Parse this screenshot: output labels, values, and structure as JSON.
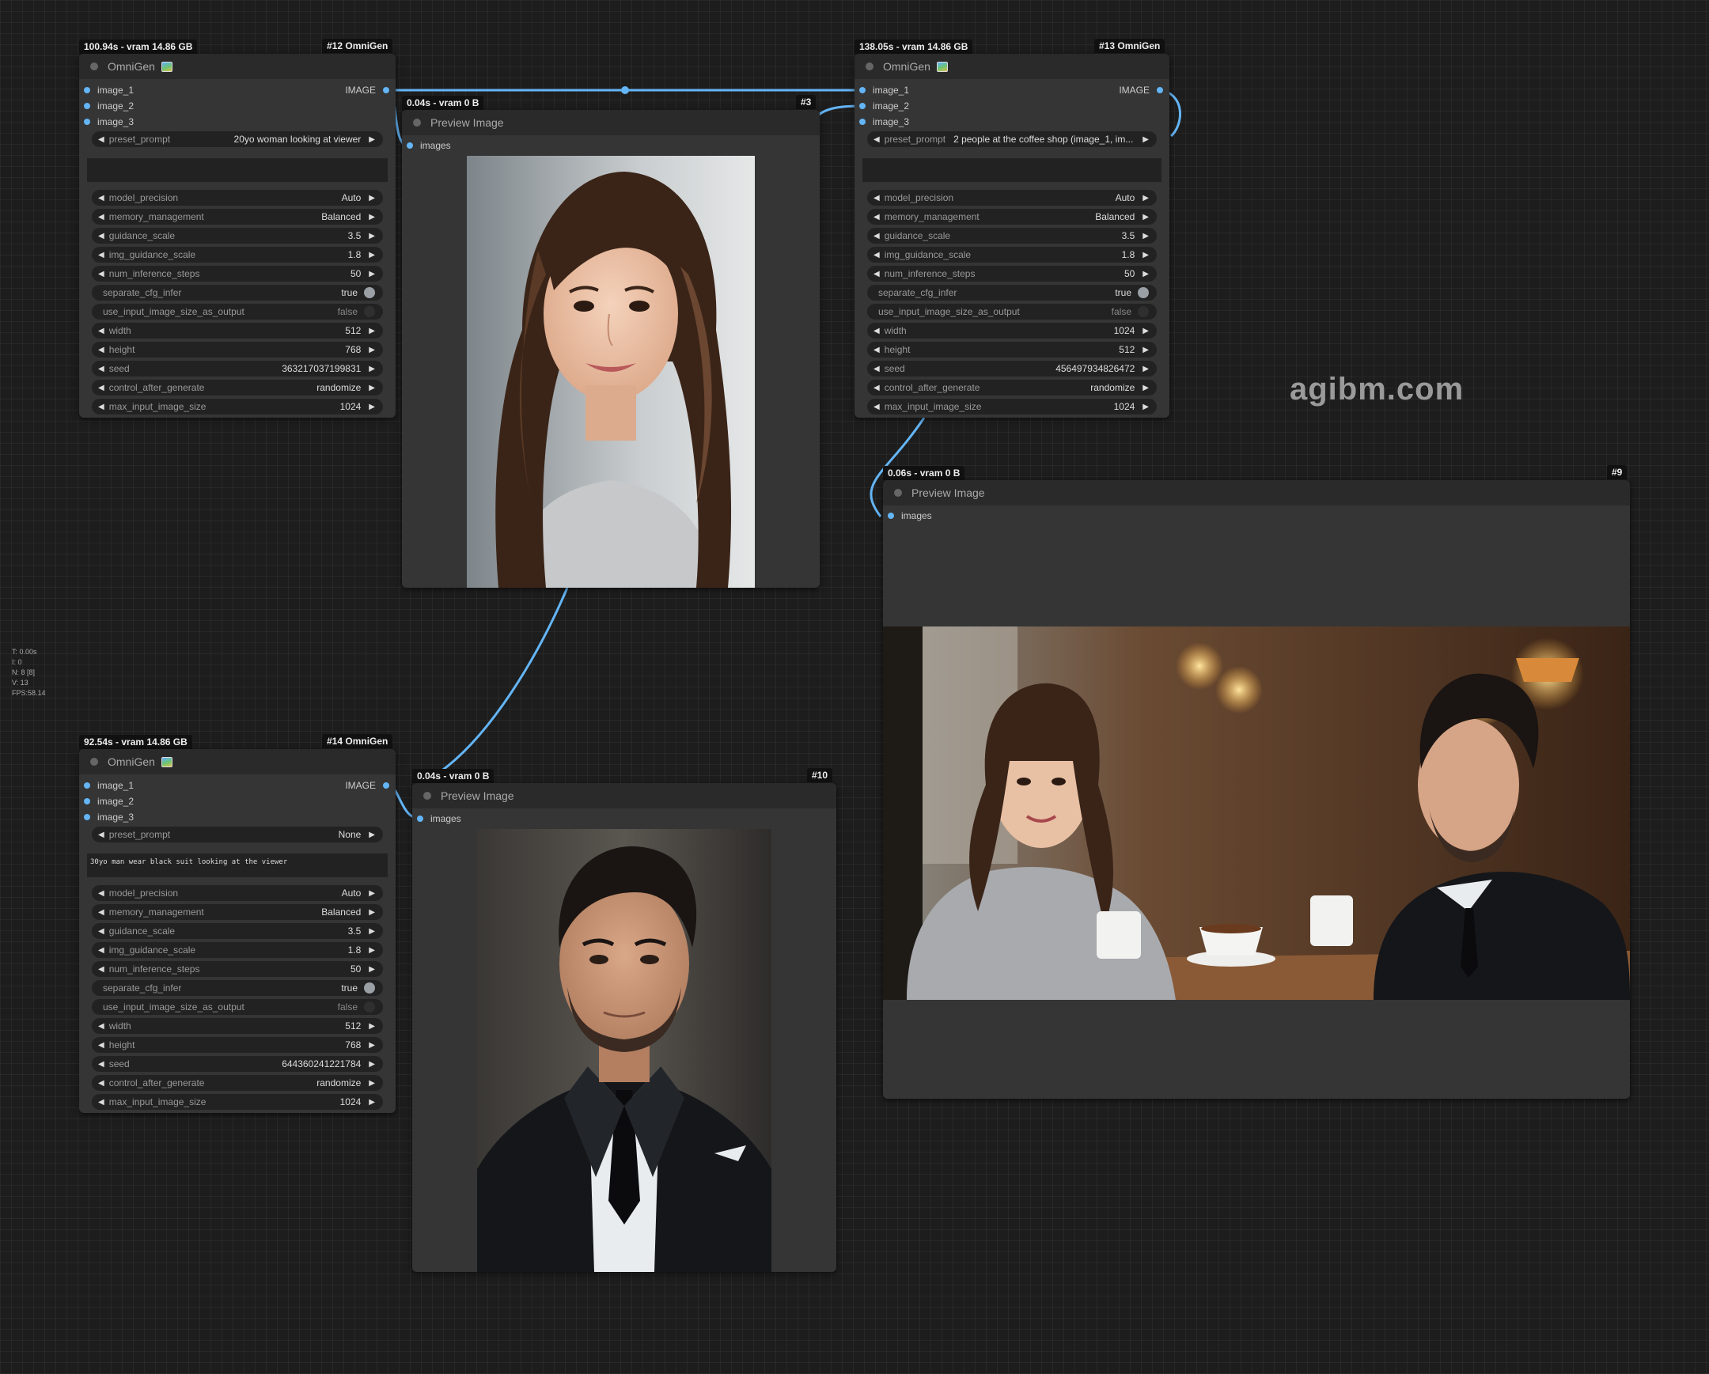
{
  "watermark": "agibm.com",
  "stats": {
    "t": "T: 0.00s",
    "i": "I: 0",
    "n": "N: 8 [8]",
    "v": "V: 13",
    "fps": "FPS:58.14"
  },
  "colors": {
    "link": "#64b5f6",
    "canvas": "#1d1d1d",
    "node": "#353535",
    "header": "#2a2a2a"
  },
  "nodes": {
    "n12": {
      "id": "#12 OmniGen",
      "timing": "100.94s - vram 14.86 GB",
      "title": "OmniGen",
      "inputs": [
        "image_1",
        "image_2",
        "image_3"
      ],
      "output": "IMAGE",
      "preset_label": "preset_prompt",
      "preset_value": "20yo woman looking at viewer",
      "prompt_text": "",
      "widgets": [
        {
          "label": "model_precision",
          "value": "Auto"
        },
        {
          "label": "memory_management",
          "value": "Balanced"
        },
        {
          "label": "guidance_scale",
          "value": "3.5"
        },
        {
          "label": "img_guidance_scale",
          "value": "1.8"
        },
        {
          "label": "num_inference_steps",
          "value": "50"
        },
        {
          "label": "separate_cfg_infer",
          "value": "true"
        },
        {
          "label": "use_input_image_size_as_output",
          "value": "false"
        },
        {
          "label": "width",
          "value": "512"
        },
        {
          "label": "height",
          "value": "768"
        },
        {
          "label": "seed",
          "value": "363217037199831"
        },
        {
          "label": "control_after_generate",
          "value": "randomize"
        },
        {
          "label": "max_input_image_size",
          "value": "1024"
        }
      ]
    },
    "n13": {
      "id": "#13 OmniGen",
      "timing": "138.05s - vram 14.86 GB",
      "title": "OmniGen",
      "inputs": [
        "image_1",
        "image_2",
        "image_3"
      ],
      "output": "IMAGE",
      "preset_label": "preset_prompt",
      "preset_value": "2 people at the coffee shop (image_1, im...",
      "prompt_text": "",
      "widgets": [
        {
          "label": "model_precision",
          "value": "Auto"
        },
        {
          "label": "memory_management",
          "value": "Balanced"
        },
        {
          "label": "guidance_scale",
          "value": "3.5"
        },
        {
          "label": "img_guidance_scale",
          "value": "1.8"
        },
        {
          "label": "num_inference_steps",
          "value": "50"
        },
        {
          "label": "separate_cfg_infer",
          "value": "true"
        },
        {
          "label": "use_input_image_size_as_output",
          "value": "false"
        },
        {
          "label": "width",
          "value": "1024"
        },
        {
          "label": "height",
          "value": "512"
        },
        {
          "label": "seed",
          "value": "456497934826472"
        },
        {
          "label": "control_after_generate",
          "value": "randomize"
        },
        {
          "label": "max_input_image_size",
          "value": "1024"
        }
      ]
    },
    "n14": {
      "id": "#14 OmniGen",
      "timing": "92.54s - vram 14.86 GB",
      "title": "OmniGen",
      "inputs": [
        "image_1",
        "image_2",
        "image_3"
      ],
      "output": "IMAGE",
      "preset_label": "preset_prompt",
      "preset_value": "None",
      "prompt_text": "30yo man wear black suit looking at the viewer",
      "widgets": [
        {
          "label": "model_precision",
          "value": "Auto"
        },
        {
          "label": "memory_management",
          "value": "Balanced"
        },
        {
          "label": "guidance_scale",
          "value": "3.5"
        },
        {
          "label": "img_guidance_scale",
          "value": "1.8"
        },
        {
          "label": "num_inference_steps",
          "value": "50"
        },
        {
          "label": "separate_cfg_infer",
          "value": "true"
        },
        {
          "label": "use_input_image_size_as_output",
          "value": "false"
        },
        {
          "label": "width",
          "value": "512"
        },
        {
          "label": "height",
          "value": "768"
        },
        {
          "label": "seed",
          "value": "644360241221784"
        },
        {
          "label": "control_after_generate",
          "value": "randomize"
        },
        {
          "label": "max_input_image_size",
          "value": "1024"
        }
      ]
    },
    "n3": {
      "id": "#3",
      "timing": "0.04s - vram 0 B",
      "title": "Preview Image",
      "input": "images"
    },
    "n9": {
      "id": "#9",
      "timing": "0.06s - vram 0 B",
      "title": "Preview Image",
      "input": "images"
    },
    "n10": {
      "id": "#10",
      "timing": "0.04s - vram 0 B",
      "title": "Preview Image",
      "input": "images"
    }
  }
}
